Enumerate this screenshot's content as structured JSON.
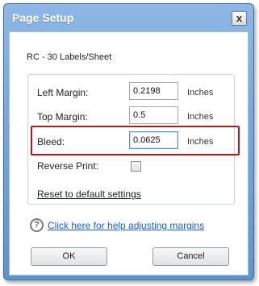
{
  "dialog": {
    "title": "Page Setup",
    "close_label": "x"
  },
  "sheet": {
    "name": "RC - 30 Labels/Sheet"
  },
  "margins": {
    "left": {
      "label": "Left Margin:",
      "value": "0.2198",
      "unit": "Inches"
    },
    "top": {
      "label": "Top Margin:",
      "value": "0.5",
      "unit": "Inches"
    },
    "bleed": {
      "label": "Bleed:",
      "value": "0.0625",
      "unit": "Inches"
    }
  },
  "reverse_print": {
    "label": "Reverse Print:",
    "checked": false
  },
  "reset_label": "Reset to default settings",
  "help": {
    "icon": "?",
    "link": "Click here for help adjusting margins"
  },
  "buttons": {
    "ok": "OK",
    "cancel": "Cancel"
  },
  "colors": {
    "title_gradient_top": "#8eb7e4",
    "title_gradient_bottom": "#5e93cf",
    "highlight_border": "#b5161c",
    "link": "#1a5ad6"
  }
}
